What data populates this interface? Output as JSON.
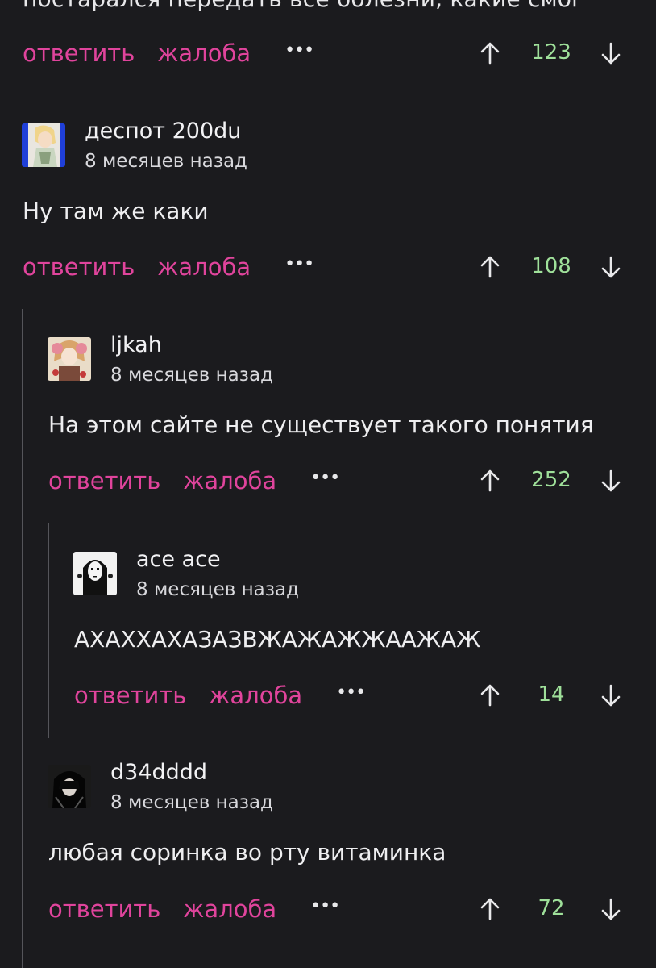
{
  "top_partial_text": "постарался передать все болезни, какие смог",
  "actions": {
    "reply_label": "ответить",
    "report_label": "жалоба",
    "more_label": "•••"
  },
  "colors": {
    "background": "#1b1b1e",
    "action_pink": "#e0449c",
    "vote_green": "#9fe09a",
    "thread_line": "#55555a"
  },
  "comments": [
    {
      "score": "123"
    },
    {
      "author": "деспот 200du",
      "time": "8 месяцев назад",
      "text": "Ну там же каки",
      "score": "108",
      "avatar_icon": "anime-girl-avatar"
    },
    {
      "author": "ljkah",
      "time": "8 месяцев назад",
      "text": "На этом сайте не существует такого понятия",
      "score": "252",
      "avatar_icon": "anime-pink-hair-avatar"
    },
    {
      "author": "ace ace",
      "time": "8 месяцев назад",
      "text": "АХАХХАХАЗАЗВЖАЖАЖЖААЖАЖ",
      "score": "14",
      "avatar_icon": "no-face-mask-avatar"
    },
    {
      "author": "d34dddd",
      "time": "8 месяцев назад",
      "text": "любая соринка во рту витаминка",
      "score": "72",
      "avatar_icon": "dark-haired-character-avatar"
    }
  ]
}
